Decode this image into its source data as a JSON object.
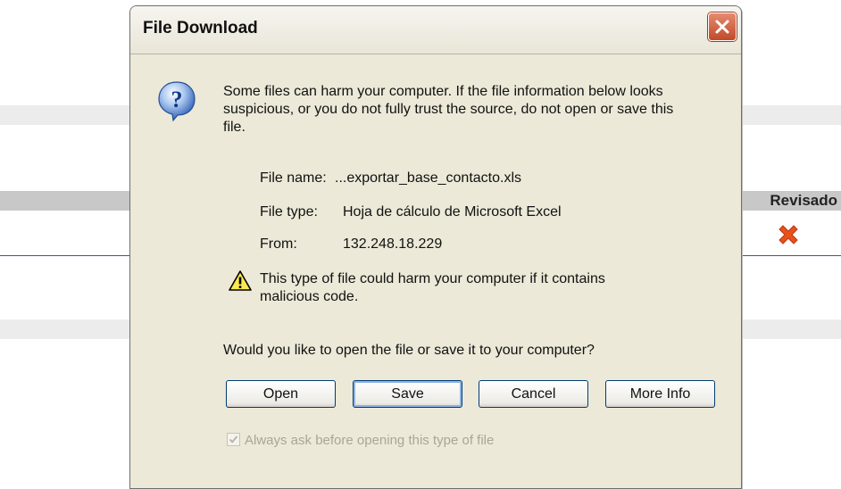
{
  "background": {
    "column_header": "Revisado",
    "reviewed_icon": "red-x-icon"
  },
  "dialog": {
    "title": "File Download",
    "close_icon": "close-icon",
    "question_icon": "question-icon",
    "intro_text": "Some files can harm your computer. If the file information below looks suspicious, or you do not fully trust the source, do not open or save this file.",
    "file": {
      "name_label": "File name:",
      "name_value": "...exportar_base_contacto.xls",
      "type_label": "File type:",
      "type_value": "Hoja de cálculo de Microsoft Excel",
      "from_label": "From:",
      "from_value": "132.248.18.229"
    },
    "warning_icon": "warning-icon",
    "warning_text": "This type of file could harm your computer if it contains malicious code.",
    "question_text": "Would you like to open the file or save it to your computer?",
    "buttons": {
      "open": "Open",
      "save": "Save",
      "cancel": "Cancel",
      "more_info": "More Info"
    },
    "always_ask_label": "Always ask before opening this type of file",
    "always_ask_checked": true
  },
  "colors": {
    "dialog_bg": "#ece9d8",
    "close_button": "#c14a2a",
    "button_border": "#003c74"
  }
}
